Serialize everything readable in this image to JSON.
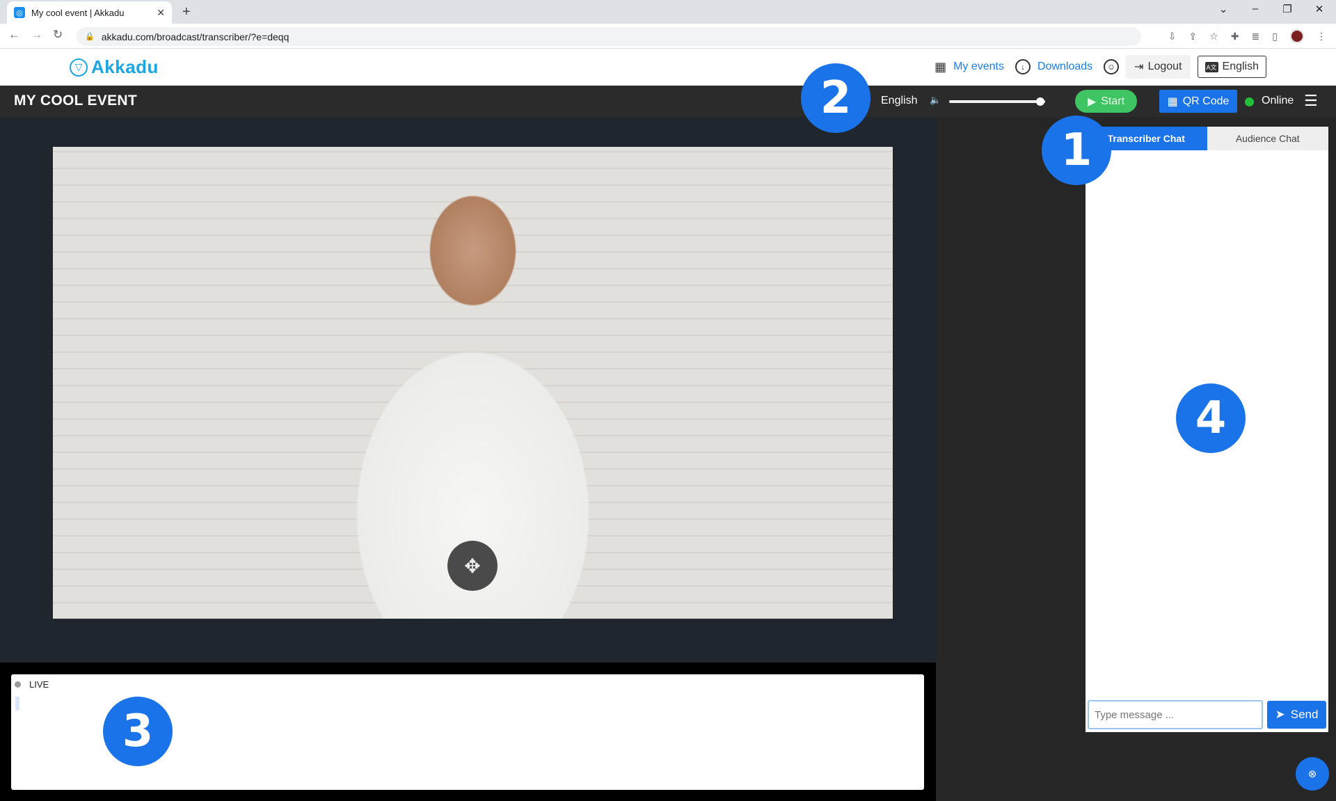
{
  "browser": {
    "tab_title": "My cool event | Akkadu",
    "url": "akkadu.com/broadcast/transcriber/?e=deqq"
  },
  "site": {
    "logo_text": "Akkadu",
    "my_events": "My events",
    "downloads": "Downloads",
    "logout": "Logout",
    "language": "English"
  },
  "event_bar": {
    "title": "MY COOL EVENT",
    "audio_language": "English",
    "volume_level": 0.95,
    "start_label": "Start",
    "qr_label": "QR Code",
    "status_label": "Online",
    "status_color": "#22c03a"
  },
  "chat": {
    "tab_transcriber": "Transcriber Chat",
    "tab_audience": "Audience Chat",
    "input_placeholder": "Type message ...",
    "send_label": "Send"
  },
  "transcript": {
    "live_label": "LIVE"
  },
  "annotations": [
    "1",
    "2",
    "3",
    "4"
  ],
  "colors": {
    "accent": "#1a73e8",
    "start_green": "#3ec463",
    "logo": "#1aa6e0"
  }
}
